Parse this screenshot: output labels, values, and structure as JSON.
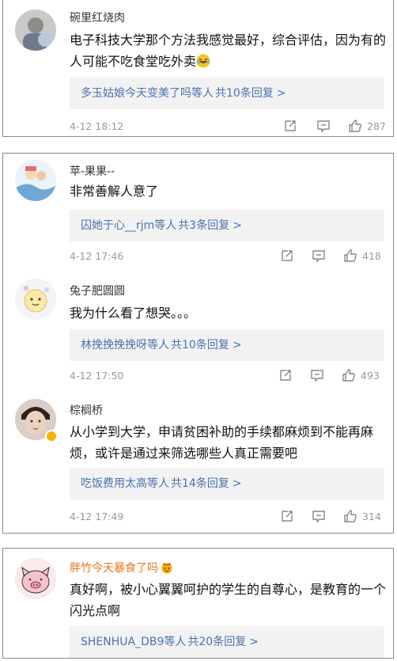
{
  "comments": [
    {
      "name": "碗里红烧肉",
      "text": "电子科技大学那个方法我感觉最好，综合评估，因为有的人可能不吃食堂吃外卖",
      "emoji": "laughing-tears",
      "reply_who": "多玉姑娘今天变美了吗等人",
      "reply_count": "共10条回复",
      "reply_arrow": ">",
      "time": "4-12 18:12",
      "likes": "287"
    },
    {
      "name": "苹-果果--",
      "text": "非常善解人意了",
      "reply_who": "囚她于心__rjm等人",
      "reply_count": "共3条回复",
      "reply_arrow": ">",
      "time": "4-12 17:46",
      "likes": "418"
    },
    {
      "name": "兔子肥圆圆",
      "text": "我为什么看了想哭。。。",
      "reply_who": "林挽挽挽挽呀等人",
      "reply_count": "共10条回复",
      "reply_arrow": ">",
      "time": "4-12 17:50",
      "likes": "493"
    },
    {
      "name": "棕榈桥",
      "text": "从小学到大学，申请贫困补助的手续都麻烦到不能再麻烦，或许是通过来筛选哪些人真正需要吧",
      "reply_who": "吃饭费用太高等人",
      "reply_count": "共14条回复",
      "reply_arrow": ">",
      "time": "4-12 17:49",
      "likes": "314"
    },
    {
      "name": "胖竹今天暴食了吗",
      "name_emoji": "crown-face",
      "text": "真好啊，被小心翼翼呵护的学生的自尊心，是教育的一个闪光点啊",
      "reply_who": "SHENHUA_DB9等人",
      "reply_count": "共20条回复",
      "reply_arrow": ">"
    }
  ],
  "icons": {
    "share": "share-icon",
    "comment": "comment-icon",
    "like": "thumbs-up-icon"
  },
  "colors": {
    "link": "#4a72b0",
    "vip_name": "#e8761c",
    "meta": "#999999",
    "reply_bg": "#f2f2f2"
  }
}
